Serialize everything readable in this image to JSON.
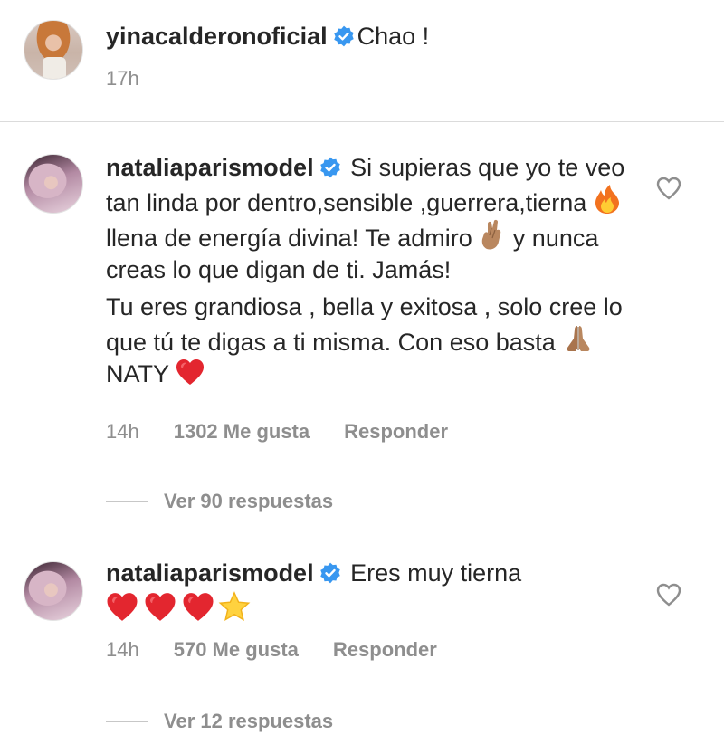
{
  "post": {
    "username": "yinacalderonoficial",
    "caption": "Chao !",
    "time": "17h"
  },
  "comments": [
    {
      "username": "nataliaparismodel",
      "text_a": "Si supieras que yo te veo tan linda por dentro,sensible ,guerrera,tierna",
      "text_b": "llena de energía divina! Te admiro",
      "text_c": "y nunca creas lo que digan de ti. Jamás!",
      "text_d": "Tu eres grandiosa , bella y exitosa , solo cree lo que tú te digas a ti misma. Con eso basta",
      "text_e": "NATY",
      "emojis": [
        "fire",
        "crossed-fingers",
        "folded-hands",
        "red-heart"
      ],
      "time": "14h",
      "likes": "1302 Me gusta",
      "reply_label": "Responder",
      "view_replies": "Ver 90 respuestas"
    },
    {
      "username": "nataliaparismodel",
      "text_a": "Eres muy tierna",
      "emojis": [
        "red-heart",
        "red-heart",
        "red-heart",
        "star"
      ],
      "time": "14h",
      "likes": "570 Me gusta",
      "reply_label": "Responder",
      "view_replies": "Ver 12 respuestas"
    }
  ],
  "colors": {
    "text": "#262626",
    "muted": "#8e8e8e",
    "verified": "#3897f0",
    "heart": "#e3262f",
    "divider": "#dbdbdb"
  }
}
